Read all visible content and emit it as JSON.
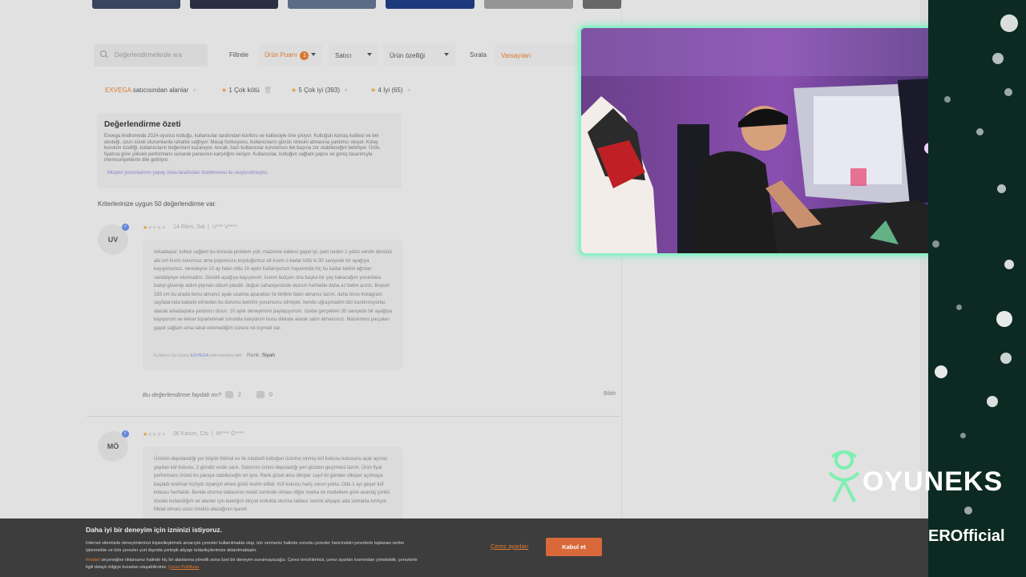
{
  "search": {
    "placeholder": "Değerlendirmelerde ara"
  },
  "filters": {
    "label": "Filtrele",
    "rating": {
      "label": "Ürün Puanı",
      "badge": "1"
    },
    "seller": "Satıcı",
    "features": "Ürün özelliği",
    "sort_label": "Sırala",
    "sort_value": "Varsayılan"
  },
  "chips": {
    "seller_name": "EXVEGA",
    "seller_suffix": "satıcısından alanlar",
    "c1_num": "1",
    "c1_label": "Çok kötü",
    "c2_num": "5",
    "c2_label": "Çok iyi (393)",
    "c3_num": "4",
    "c3_label": "İyi (65)"
  },
  "summary": {
    "title": "Değerlendirme özeti",
    "text": "Exvega Andromeda 2024 oyuncu koltuğu, kullanıcılar tarafından konforu ve kalitesiyle öne çıkıyor. Koltuğun kumaş kalitesi ve bel desteği, uzun süreli oturumlarda rahatlık sağlıyor. Masaj fonksiyonu, kullanıcıların günün stresini atmasına yardımcı oluyor. Kolay kurulum özelliği, kullanıcıların beğenisini kazanıyor. Ancak, bazı kullanıcılar kurulumun tek başına zor olabileceğini belirtiyor. Ürün, fiyatına göre yüksek performans sunarak parasının karşılığını veriyor. Kullanıcılar, koltuğun sağlam yapısı ve geniş tasarımıyla memnuniyetlerini dile getiriyor.",
    "note": "Müşteri yorumlarının yapay zeka tarafından özetlenmesi ile oluşturulmuştur."
  },
  "results_count": "Kriterlerinize uygun 50 değerlendirme var.",
  "reviews": [
    {
      "initials": "UV",
      "date": "14 Ekim, Sal",
      "user": "U*** V****",
      "text": "Arkadaşlar, koltuk sağlam bu konuda problem yok; malzeme kalitesi gayet iyi, peki neden 1 yıldız verdin dersiniz abi sırt kısmı sorunsuz ama popomuzu koyduğumuz alt kısmı o kadar kötü ki 30 saniyede bir ayağıya kayıyorsunuz. neredeyse 10 ay falan oldu 10 aydır kullanıyorum hayatımda hiç bu kadar belimi ağrıtan sandalyeye oturmadım. Sürekli aşağıya kayıyorum. inanın bulçum oha başka bir şey bakacağım yorumlara bakıp güvenip aldım pişman oldum plastik. duğun sahasiyesinde oturum herhalde daha az belim acırdı. Boyum 183 cm bu arada bunu almanız ayak uzatma aparatları ile birlikte falan almanız lazım, daha önce instagram sayfalarında kabalık etmeden bu durumu belirtim yorumumu silmişler, bende uğraşmadım bizi kandırmıyorlar. alacak arkadaşlara yardımcı olsun. 10 aylık deneyimimi paylaşıyorum. özetle gerçekten 30 saniyede bir ayağıya kayıyorum ve tekrar toparlanmak zorunda kalıyorum bunu dikkate alarak satın almalısınız. Malzemesi parçaları gayet sağlam ama rahat edemediğim sürece ne kıymeti var.",
      "seller_prefix": "Kullanıcı bu ürünü",
      "seller_name": "EXVEGA",
      "seller_suffix": "satıcısından aldı.",
      "color_label": "Renk",
      "color_value": "Siyah",
      "helpful": "Bu değerlendirme faydalı mı?",
      "up": "2",
      "down": "0",
      "report": "Bildir"
    },
    {
      "initials": "MÖ",
      "date": "06 Kasım, Cts",
      "user": "M**** Ö****",
      "text": "Ürünün depolandığı yer büyük ihtimal ev ile rutubetli koltuğun üzerine sinmiş küf kokusu kutusunu açar açmaz yayılan küf kokusu, 2 gündür evde sarılı. Satıcının ürünü depoladığı yeri gözden geçirmesi lazım. Ürün fiyat performans ürünü bu paraya olabileceğin en iyisi. Renk güzel ama dikişler zayıf iki günden dikişler açılmaya başladı teslimat hızlıydı siparişin ertesi günü teslim edildi. Küf kokusu hariç sorun yoktu. Oda 1 ayı geçer küf kokusu herhalde. Bende oturma tablasının metal zeminde olması diğer marka ve modellere göre avantaj çünkü önceki kullandığım ve alanlar için baktığım birçok koltukta oturma tablası zemini ahşaptı ada zamanla kırılıyor. Metal olması uzun ömürlü alacağının işareti"
    }
  ],
  "cookie": {
    "title": "Daha iyi bir deneyim için izninizi istiyoruz.",
    "line1": "İnternet sitemizde deneyimlerinizi kişiselleştirmek amacıyla çerezler kullanılmakta olup, izin vermeniz halinde zorunlu çerezler haricindeki çerezlerle toplanan veriler",
    "line2": "işlenmekte ve tüm çerezler yurt dışında yerleşik altyapı tedarikçilerimize aktarılmaktadır.",
    "line3_link": "Reddet",
    "line3": "seçeneğine tıklarsanız halinde hiç bir alanlarına yönelik sona özel bir deneyim sunamayacağız. Çerez tercihlerinizi, çerez ayarları kısmından yönetebilir, çerezlerle",
    "line4": "ilgili detaylı bilgiye buradan ulaşabilirsiniz:",
    "line4_link": "Çerez Politikası",
    "settings": "Çerez ayarları",
    "accept": "Kabul et"
  },
  "overlay": {
    "brand": "OYUNEKS",
    "official": "EROfficial"
  },
  "colors": {
    "accent": "#e07a30",
    "cam_border": "#8ff0c8",
    "side_bg": "#0c2a22"
  }
}
